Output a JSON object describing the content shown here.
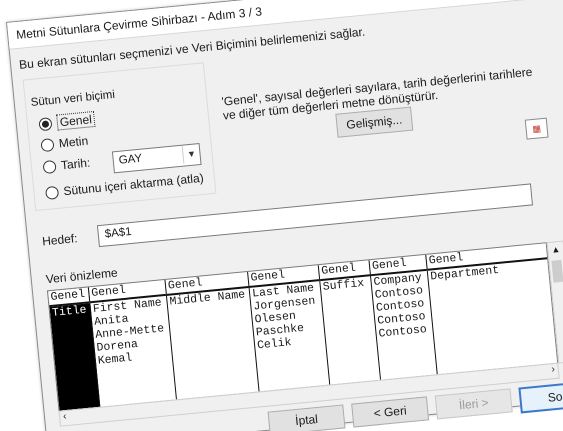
{
  "window": {
    "title": "Metni Sütunlara Çevirme Sihirbazı - Adım 3 / 3"
  },
  "instruction": "Bu ekran sütunları seçmenizi ve Veri Biçimini belirlemenizi  sağlar.",
  "format_group": {
    "label": "Sütun veri biçimi",
    "options": [
      {
        "label": "Genel",
        "checked": true
      },
      {
        "label": "Metin",
        "checked": false
      },
      {
        "label": "Tarih:",
        "checked": false
      },
      {
        "label": "Sütunu içeri aktarma (atla)",
        "checked": false
      }
    ],
    "date_format": "GAY"
  },
  "info_text_line1": "'Genel', sayısal değerleri sayılara, tarih değerlerini tarihlere",
  "info_text_line2": "ve diğer tüm değerleri metne dönüştürür.",
  "advanced_button": "Gelişmiş...",
  "destination": {
    "label": "Hedef:",
    "value": "$A$1"
  },
  "preview": {
    "label": "Veri önizleme",
    "columns": [
      {
        "header": "Genel",
        "cells": [
          "Title",
          "",
          "",
          "",
          ""
        ]
      },
      {
        "header": "Genel",
        "cells": [
          "First Name",
          "Anita",
          "Anne-Mette",
          "Dorena",
          "Kemal"
        ]
      },
      {
        "header": "Genel",
        "cells": [
          "Middle Name",
          "",
          "",
          "",
          ""
        ]
      },
      {
        "header": "Genel",
        "cells": [
          "Last Name",
          "Jorgensen",
          "Olesen",
          "Paschke",
          "Celik"
        ]
      },
      {
        "header": "Genel",
        "cells": [
          "Suffix",
          "",
          "",
          "",
          ""
        ]
      },
      {
        "header": "Genel",
        "cells": [
          "Company",
          "Contoso",
          "Contoso",
          "Contoso",
          "Contoso"
        ]
      },
      {
        "header": "Genel",
        "cells": [
          "Department",
          "",
          "",
          "",
          ""
        ]
      }
    ]
  },
  "buttons": {
    "cancel": "İptal",
    "back": "< Geri",
    "next": "İleri >",
    "finish": "Son"
  }
}
